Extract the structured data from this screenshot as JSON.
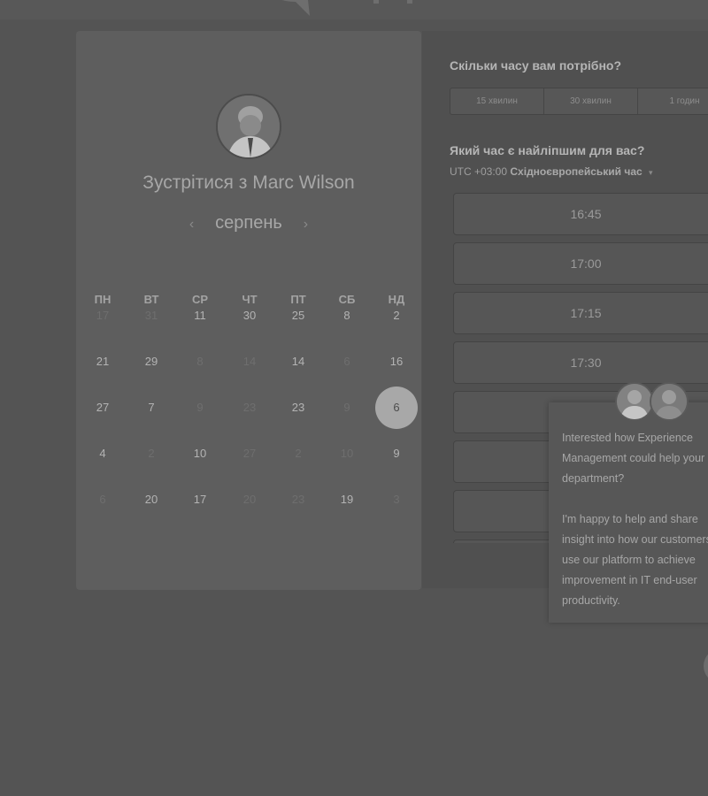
{
  "scheduler": {
    "meet_title": "Зустрітися з Marc Wilson",
    "prev_arrow": "‹",
    "next_arrow": "›",
    "month": "серпень",
    "weekdays": [
      "ПН",
      "ВТ",
      "СР",
      "ЧТ",
      "ПТ",
      "СБ",
      "НД"
    ],
    "weeks": [
      [
        {
          "n": "17",
          "off": true
        },
        {
          "n": "31",
          "off": true
        },
        {
          "n": "11"
        },
        {
          "n": "30"
        },
        {
          "n": "25"
        },
        {
          "n": "8"
        },
        {
          "n": "2"
        }
      ],
      [
        {
          "n": "21"
        },
        {
          "n": "29"
        },
        {
          "n": "8",
          "off": true
        },
        {
          "n": "14",
          "off": true
        },
        {
          "n": "14"
        },
        {
          "n": "6",
          "off": true
        },
        {
          "n": "16"
        }
      ],
      [
        {
          "n": "27"
        },
        {
          "n": "7"
        },
        {
          "n": "9",
          "off": true
        },
        {
          "n": "23",
          "off": true
        },
        {
          "n": "23"
        },
        {
          "n": "9",
          "off": true
        },
        {
          "n": "6",
          "selected": true
        }
      ],
      [
        {
          "n": "4"
        },
        {
          "n": "2",
          "off": true
        },
        {
          "n": "10"
        },
        {
          "n": "27",
          "off": true
        },
        {
          "n": "2",
          "off": true
        },
        {
          "n": "10",
          "off": true
        },
        {
          "n": "9"
        }
      ],
      [
        {
          "n": "6",
          "off": true
        },
        {
          "n": "20"
        },
        {
          "n": "17"
        },
        {
          "n": "20",
          "off": true
        },
        {
          "n": "23",
          "off": true
        },
        {
          "n": "19"
        },
        {
          "n": "3",
          "off": true
        }
      ]
    ]
  },
  "booking": {
    "duration_title": "Скільки часу вам потрібно?",
    "durations": [
      "15 хвилин",
      "30 хвилин",
      "1 годин"
    ],
    "time_title": "Який час є найліпшим для вас?",
    "timezone_offset": "UTC +03:00",
    "timezone_name": "Східноєвропейський час",
    "timezone_caret": "▾",
    "slots": [
      "16:45",
      "17:00",
      "17:15",
      "17:30",
      "",
      "",
      "",
      ""
    ]
  },
  "chat": {
    "paragraph1": "Interested how Experience Management could help your department?",
    "paragraph2": "I'm happy to help and share insight into how our customers use our platform to achieve improvement in IT end-user productivity."
  },
  "colors": {
    "selected_day": "#a8a8a8",
    "panel": "#505050",
    "card": "#5e5e5e"
  }
}
